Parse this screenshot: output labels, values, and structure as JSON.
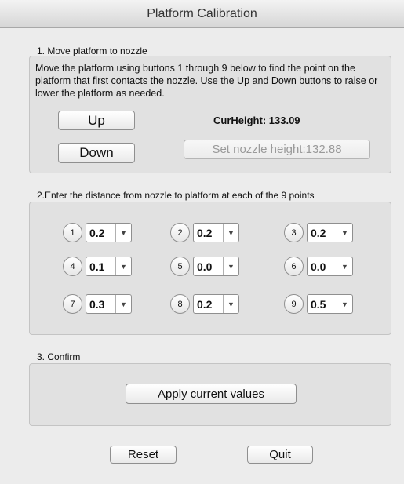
{
  "window": {
    "title": "Platform Calibration"
  },
  "section1": {
    "label": "1. Move platform to nozzle",
    "description": "Move the platform using buttons 1 through 9 below to find the point on the platform that first contacts the nozzle.  Use the Up and Down buttons to raise or lower the platform as needed.",
    "up_label": "Up",
    "down_label": "Down",
    "cur_height": "CurHeight: 133.09",
    "set_nozzle_label": "Set nozzle height:132.88"
  },
  "section2": {
    "label": "2.Enter the distance from nozzle to platform at each of the 9 points",
    "points": [
      {
        "number": "1",
        "value": "0.2"
      },
      {
        "number": "2",
        "value": "0.2"
      },
      {
        "number": "3",
        "value": "0.2"
      },
      {
        "number": "4",
        "value": "0.1"
      },
      {
        "number": "5",
        "value": "0.0"
      },
      {
        "number": "6",
        "value": "0.0"
      },
      {
        "number": "7",
        "value": "0.3"
      },
      {
        "number": "8",
        "value": "0.2"
      },
      {
        "number": "9",
        "value": "0.5"
      }
    ],
    "dropdown_arrow": "▼"
  },
  "section3": {
    "label": "3. Confirm",
    "apply_label": "Apply current values"
  },
  "footer": {
    "reset_label": "Reset",
    "quit_label": "Quit"
  }
}
